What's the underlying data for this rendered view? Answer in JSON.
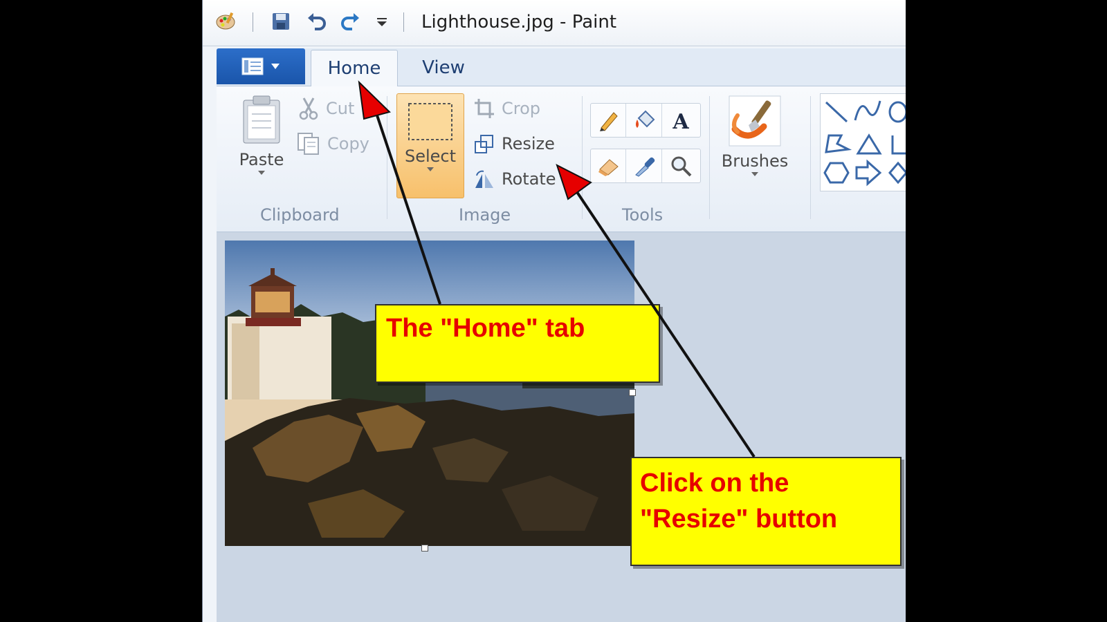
{
  "window": {
    "title": "Lighthouse.jpg - Paint"
  },
  "quick_access": {
    "icons": [
      "paint-app-icon",
      "save-icon",
      "undo-icon",
      "redo-icon",
      "customize-qat-icon"
    ]
  },
  "tabs": [
    {
      "label": "Home",
      "active": true
    },
    {
      "label": "View",
      "active": false
    }
  ],
  "ribbon": {
    "clipboard": {
      "group_label": "Clipboard",
      "paste_label": "Paste",
      "cut_label": "Cut",
      "copy_label": "Copy"
    },
    "image": {
      "group_label": "Image",
      "select_label": "Select",
      "crop_label": "Crop",
      "resize_label": "Resize",
      "rotate_label": "Rotate"
    },
    "tools": {
      "group_label": "Tools",
      "items": [
        "pencil-icon",
        "fill-icon",
        "text-icon",
        "eraser-icon",
        "color-picker-icon",
        "magnifier-icon"
      ]
    },
    "brushes": {
      "label": "Brushes"
    },
    "shapes": {
      "items": [
        "line-icon",
        "curve-icon",
        "oval-icon",
        "polygon-icon",
        "triangle-icon",
        "right-triangle-icon",
        "hexagon-icon",
        "arrow-right-icon",
        "diamond-icon"
      ]
    }
  },
  "annotations": {
    "home_tab_callout": "The \"Home\" tab",
    "resize_callout_line1": "Click on the",
    "resize_callout_line2": "\"Resize\" button"
  },
  "colors": {
    "callout_background": "#ffff00",
    "callout_text": "#e60000",
    "arrow_head": "#e60000",
    "select_highlight": "#f8c87a",
    "app_menu_blue": "#1a55aa"
  }
}
